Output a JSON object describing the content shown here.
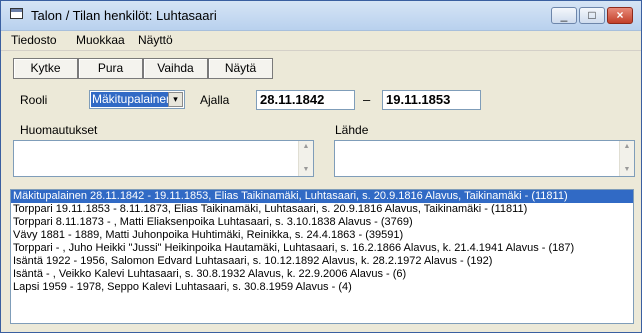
{
  "window": {
    "title": "Talon / Tilan henkilöt: Luhtasaari"
  },
  "window_controls": {
    "minimize": "_",
    "maximize": "□",
    "close": "×"
  },
  "menu": {
    "items": [
      "Tiedosto",
      "Muokkaa",
      "Näyttö"
    ]
  },
  "toolbar": {
    "buttons": [
      "Kytke",
      "Pura",
      "Vaihda",
      "Näytä"
    ]
  },
  "form": {
    "role_label": "Rooli",
    "role_value": "Mäkitupalainen",
    "period_label": "Ajalla",
    "start_date": "28.11.1842",
    "separator": "–",
    "end_date": "19.11.1853",
    "notes_label": "Huomautukset",
    "source_label": "Lähde",
    "notes_value": "",
    "source_value": ""
  },
  "list": {
    "rows": [
      "Mäkitupalainen 28.11.1842 - 19.11.1853, Elias Taikinamäki, Luhtasaari,  s. 20.9.1816 Alavus, Taikinamäki - (11811)",
      "Torppari 19.11.1853 - 8.11.1873, Elias Taikinamäki, Luhtasaari,  s. 20.9.1816 Alavus, Taikinamäki - (11811)",
      "Torppari 8.11.1873 -  , Matti Eliaksenpoika Luhtasaari,  s. 3.10.1838 Alavus - (3769)",
      "Vävy 1881 - 1889, Matti Juhonpoika Huhtimäki, Reinikka,  s. 24.4.1863 - (39591)",
      "Torppari  -  , Juho Heikki \"Jussi\" Heikinpoika Hautamäki, Luhtasaari,  s. 16.2.1866 Alavus, k. 21.4.1941 Alavus - (187)",
      "Isäntä 1922 - 1956, Salomon Edvard Luhtasaari,  s. 10.12.1892 Alavus, k. 28.2.1972 Alavus - (192)",
      "Isäntä  -  , Veikko Kalevi Luhtasaari,  s. 30.8.1932 Alavus, k. 22.9.2006 Alavus - (6)",
      "Lapsi 1959 - 1978, Seppo Kalevi Luhtasaari,  s. 30.8.1959 Alavus - (4)"
    ],
    "selected_index": 0
  },
  "icons": {
    "app": "window-app-icon",
    "combo_arrow": "▾",
    "scroll_up": "▲",
    "scroll_down": "▼"
  }
}
